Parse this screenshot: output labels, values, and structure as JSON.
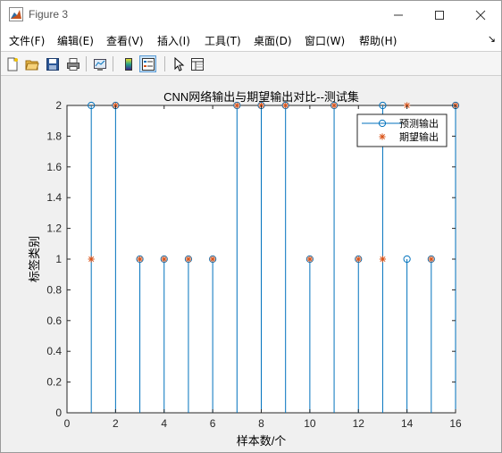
{
  "window": {
    "title": "Figure 3",
    "minimize_icon": "minimize-icon",
    "maximize_icon": "maximize-icon",
    "close_icon": "close-icon"
  },
  "menu": {
    "items": [
      "文件(F)",
      "编辑(E)",
      "查看(V)",
      "插入(I)",
      "工具(T)",
      "桌面(D)",
      "窗口(W)",
      "帮助(H)"
    ],
    "overflow_glyph": "↘"
  },
  "toolbar": {
    "buttons": [
      "new-figure-icon",
      "open-file-icon",
      "save-icon",
      "print-icon",
      "link-plot-icon",
      "insert-colorbar-icon",
      "insert-legend-icon",
      "edit-plot-arrow-icon",
      "property-inspector-icon"
    ],
    "active": "insert-legend-icon"
  },
  "chart_data": {
    "type": "stem",
    "title": "CNN网络输出与期望输出对比--测试集",
    "xlabel": "样本数/个",
    "ylabel": "标签类别",
    "xlim": [
      0,
      16
    ],
    "ylim": [
      0,
      2
    ],
    "xticks": [
      "0",
      "2",
      "4",
      "6",
      "8",
      "10",
      "12",
      "14",
      "16"
    ],
    "yticks": [
      "0",
      "0.2",
      "0.4",
      "0.6",
      "0.8",
      "1",
      "1.2",
      "1.4",
      "1.6",
      "1.8",
      "2"
    ],
    "x": [
      1,
      2,
      3,
      4,
      5,
      6,
      7,
      8,
      9,
      10,
      11,
      12,
      13,
      14,
      15,
      16
    ],
    "series": [
      {
        "name": "预测输出",
        "values": [
          2,
          2,
          1,
          1,
          1,
          1,
          2,
          2,
          2,
          1,
          2,
          1,
          2,
          1,
          1,
          2
        ],
        "color": "#0072bd",
        "marker": "o"
      },
      {
        "name": "期望输出",
        "values": [
          1,
          2,
          1,
          1,
          1,
          1,
          2,
          2,
          2,
          1,
          2,
          1,
          1,
          2,
          1,
          2
        ],
        "color": "#d95319",
        "marker": "*"
      }
    ],
    "legend": "top-right",
    "grid": false
  }
}
